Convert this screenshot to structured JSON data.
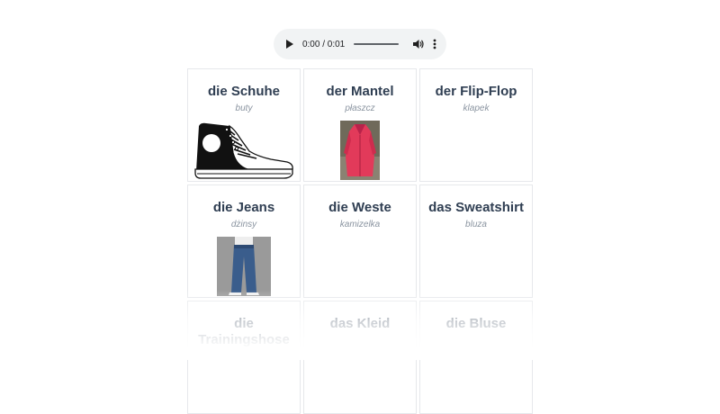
{
  "audio": {
    "time": "0:00 / 0:01",
    "progress": 0,
    "icons": {
      "play": "play-icon",
      "volume": "volume-icon",
      "more": "more-vert-icon"
    }
  },
  "cards": [
    {
      "word": "die Schuhe",
      "translation": "buty",
      "image": "sneaker-image"
    },
    {
      "word": "der Mantel",
      "translation": "płaszcz",
      "image": "coat-photo"
    },
    {
      "word": "der Flip-Flop",
      "translation": "klapek"
    },
    {
      "word": "die Jeans",
      "translation": "dżinsy",
      "image": "jeans-photo"
    },
    {
      "word": "die Weste",
      "translation": "kamizelka"
    },
    {
      "word": "das Sweatshirt",
      "translation": "bluza"
    },
    {
      "word": "die Trainingshose",
      "translation": ""
    },
    {
      "word": "das Kleid",
      "translation": ""
    },
    {
      "word": "die Bluse",
      "translation": ""
    }
  ],
  "colors": {
    "word": "#2f3e52",
    "translation": "#8a94a0",
    "card_border": "#e6e8eb",
    "player_bg": "#f1f3f4"
  }
}
